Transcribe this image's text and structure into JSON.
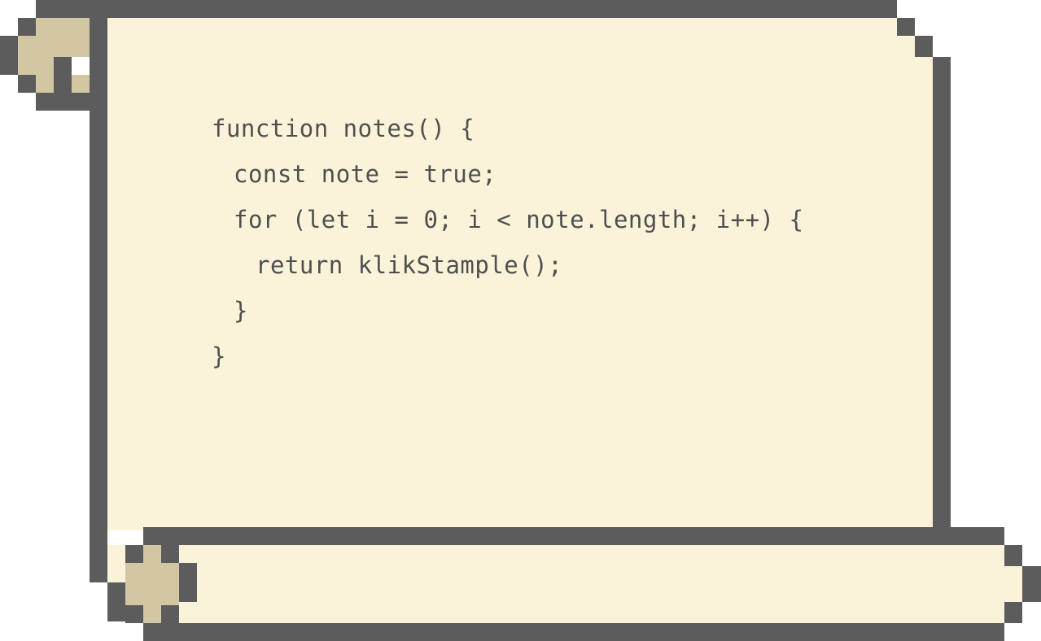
{
  "colors": {
    "outline": "#5c5c5c",
    "paper": "#fbf3d9",
    "corner": "#d2c6a3",
    "text": "#4f4f4f"
  },
  "code": {
    "lines": [
      {
        "text": "function notes() {"
      },
      {
        "text": "const note = true;"
      },
      {
        "text": "for (let i = 0; i < note.length; i++) {"
      },
      {
        "text": "return klikStample();"
      },
      {
        "text": "}"
      },
      {
        "text": "}"
      }
    ]
  }
}
